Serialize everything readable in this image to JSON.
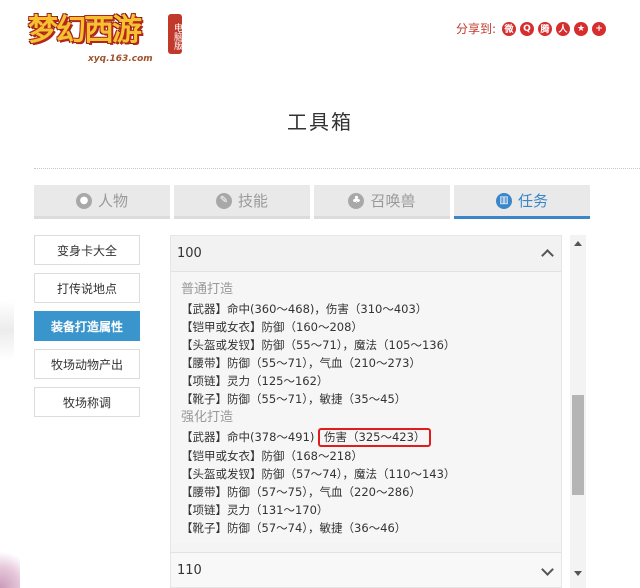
{
  "header": {
    "logo_text": "梦幻西游",
    "logo_badge": "电脑版",
    "logo_url": "xyq.163.com",
    "share_label": "分享到:",
    "share_icons": [
      "weibo-icon",
      "qzone-icon",
      "tencent-weibo-icon",
      "renren-icon",
      "favorite-icon",
      "more-icon"
    ]
  },
  "page": {
    "title": "工具箱"
  },
  "tabs": [
    {
      "label": "人物",
      "icon": "person-icon",
      "active": false
    },
    {
      "label": "技能",
      "icon": "skill-icon",
      "active": false
    },
    {
      "label": "召唤兽",
      "icon": "pet-icon",
      "active": false
    },
    {
      "label": "任务",
      "icon": "task-icon",
      "active": true
    }
  ],
  "sidebar": {
    "items": [
      {
        "label": "变身卡大全",
        "active": false
      },
      {
        "label": "打传说地点",
        "active": false
      },
      {
        "label": "装备打造属性",
        "active": true
      },
      {
        "label": "牧场动物产出",
        "active": false
      },
      {
        "label": "牧场称调",
        "active": false
      }
    ]
  },
  "accordion": {
    "open_header": "100",
    "closed_header": "110",
    "normal_title": "普通打造",
    "normal_lines": [
      "【武器】命中(360～468)，伤害（310～403）",
      "【铠甲或女衣】防御（160～208）",
      "【头盔或发钗】防御（55～71），魔法（105～136）",
      "【腰带】防御（55～71），气血（210～273）",
      "【项链】灵力（125～162）",
      "【靴子】防御（55～71），敏捷（35～45）"
    ],
    "strong_title": "强化打造",
    "strong_weapon_prefix": "【武器】命中(378～491)",
    "strong_weapon_highlight": "伤害（325～423）",
    "strong_lines": [
      "【铠甲或女衣】防御（168～218）",
      "【头盔或发钗】防御（57～74），魔法（110～143）",
      "【腰带】防御（57～75），气血（220～286）",
      "【项链】灵力（131～170）",
      "【靴子】防御（57～74），敏捷（36～46）"
    ]
  },
  "colors": {
    "accent": "#3a86c8",
    "highlight_border": "#e21c1c",
    "nav_active": "#3a95cc"
  }
}
